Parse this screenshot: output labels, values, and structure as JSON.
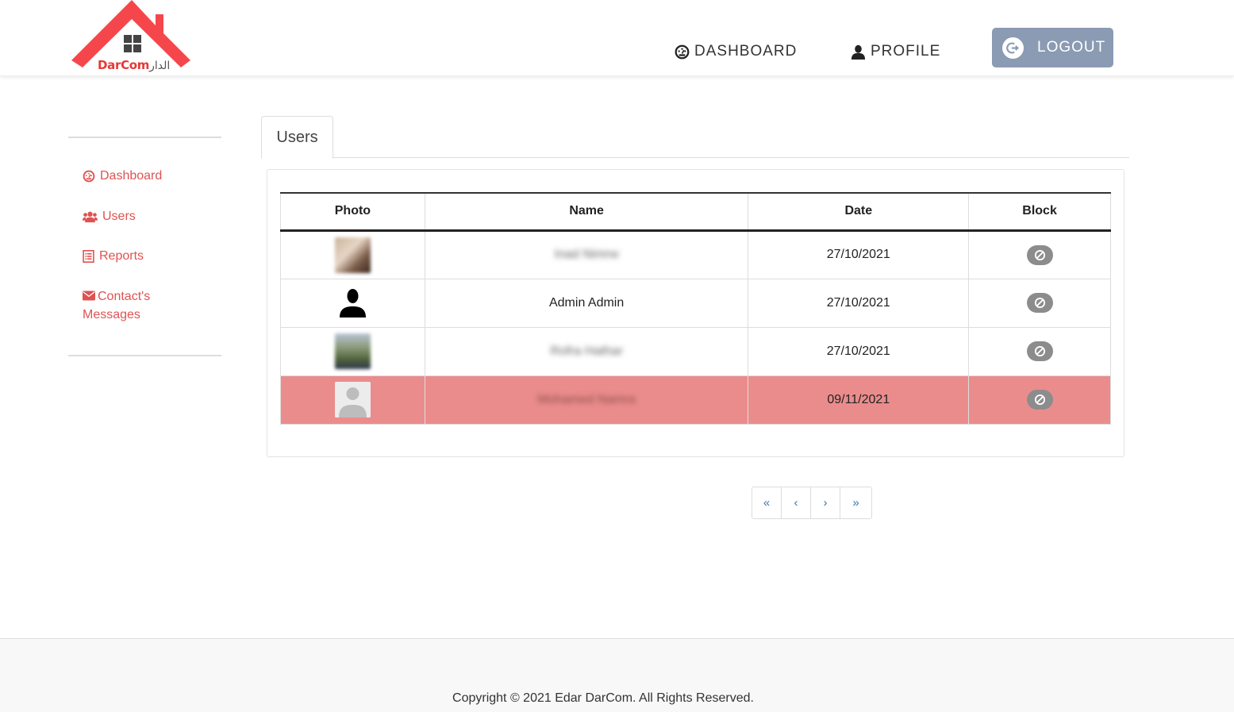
{
  "brand": {
    "logo_text": "DarCom",
    "logo_text_ar": "الدار",
    "accent": "#f5474b"
  },
  "nav": {
    "dashboard_label": "DASHBOARD",
    "profile_label": "PROFILE",
    "logout_label": "LOGOUT"
  },
  "sidebar": {
    "items": [
      {
        "label": "Dashboard",
        "icon": "dashboard-gauge-icon"
      },
      {
        "label": "Users",
        "icon": "users-icon"
      },
      {
        "label": "Reports",
        "icon": "list-icon"
      },
      {
        "label": "Contact's Messages",
        "icon": "envelope-icon"
      }
    ]
  },
  "tabs": {
    "users_label": "Users"
  },
  "table": {
    "headers": {
      "photo": "Photo",
      "name": "Name",
      "date": "Date",
      "block": "Block"
    },
    "rows": [
      {
        "name": "Inad Nimrw",
        "date": "27/10/2021",
        "blocked": false,
        "avatar": "photo"
      },
      {
        "name": "Admin Admin",
        "date": "27/10/2021",
        "blocked": false,
        "avatar": "silhouette"
      },
      {
        "name": "Rofra Hathar",
        "date": "27/10/2021",
        "blocked": false,
        "avatar": "photo"
      },
      {
        "name": "Mohamed Namra",
        "date": "09/11/2021",
        "blocked": true,
        "avatar": "default"
      }
    ]
  },
  "pagination": {
    "first": "«",
    "prev": "‹",
    "next": "›",
    "last": "»"
  },
  "footer": {
    "copyright": "Copyright © 2021 Edar DarCom. All Rights Reserved."
  },
  "colors": {
    "sidebar_link": "#e05252",
    "logout_bg": "#8a9bb3",
    "blocked_row": "#eb8c8c",
    "block_button": "#8c8c8c"
  }
}
